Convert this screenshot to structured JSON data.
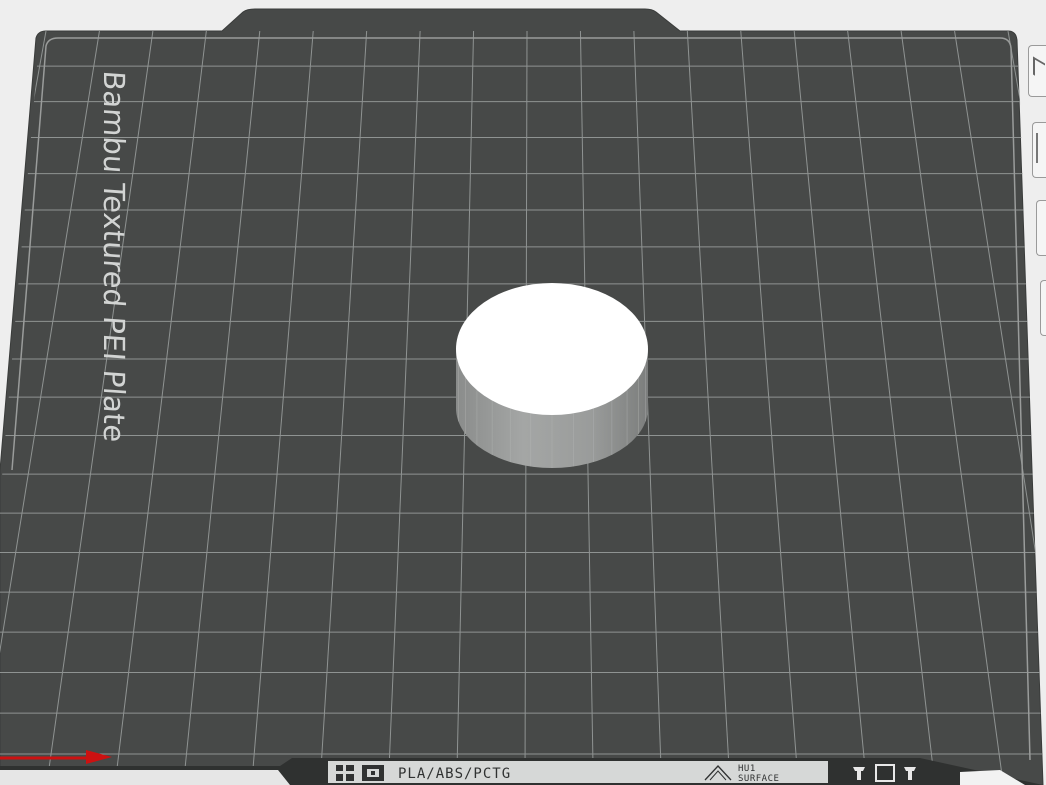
{
  "plate": {
    "name": "Bambu Textured PEI Plate",
    "bed_color": "#474948",
    "grid_color": "#8f9392",
    "edge_color": "#9a9c9b"
  },
  "bottom_strip": {
    "materials": "PLA/ABS/PCTG",
    "surface_line1": "HU1",
    "surface_line2": "SURFACE"
  },
  "object": {
    "name": "cylinder",
    "top_color": "#ffffff",
    "side_color": "#9c9e9d"
  },
  "axis": {
    "x_color": "#cc1111"
  }
}
